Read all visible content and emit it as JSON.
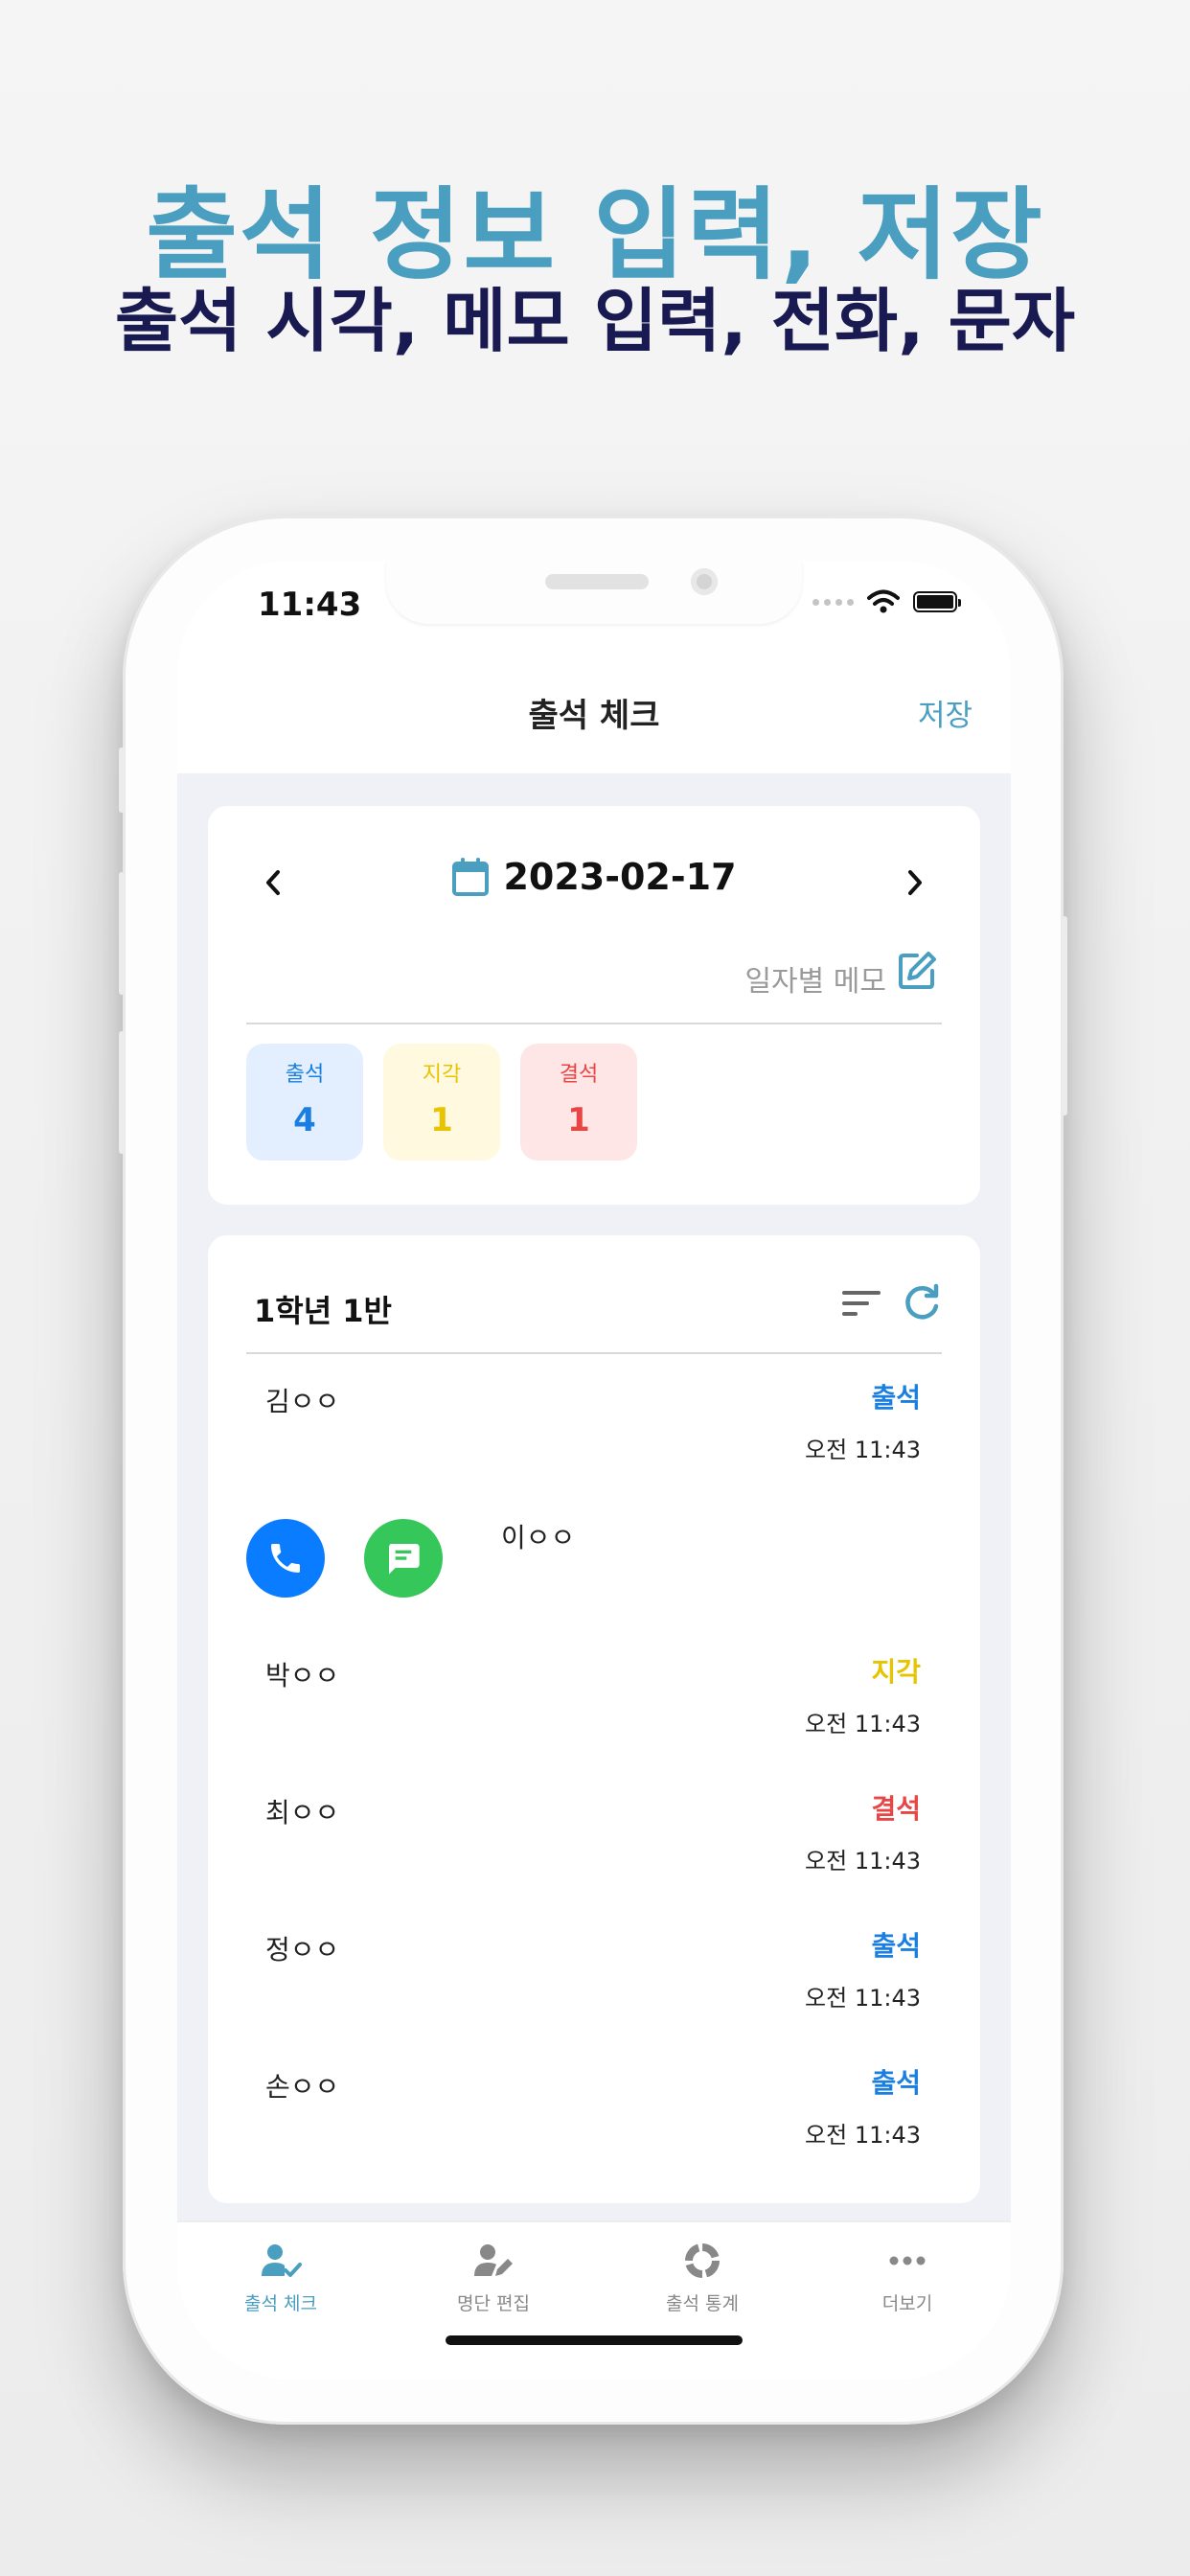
{
  "promo": {
    "title": "출석 정보 입력, 저장",
    "subtitle": "출석 시각, 메모 입력, 전화, 문자"
  },
  "status_bar": {
    "time": "11:43"
  },
  "navbar": {
    "title": "출석 체크",
    "save_label": "저장"
  },
  "date_card": {
    "date": "2023-02-17",
    "memo_placeholder": "일자별 메모",
    "stats": [
      {
        "label": "출석",
        "count": "4"
      },
      {
        "label": "지각",
        "count": "1"
      },
      {
        "label": "결석",
        "count": "1"
      }
    ]
  },
  "class_card": {
    "class_name": "1학년 1반",
    "rows": [
      {
        "name": "김ㅇㅇ",
        "status": "출석",
        "time": "오전 11:43"
      },
      {
        "name": "이ㅇㅇ",
        "status": "",
        "time": ""
      },
      {
        "name": "박ㅇㅇ",
        "status": "지각",
        "time": "오전 11:43"
      },
      {
        "name": "최ㅇㅇ",
        "status": "결석",
        "time": "오전 11:43"
      },
      {
        "name": "정ㅇㅇ",
        "status": "출석",
        "time": "오전 11:43"
      },
      {
        "name": "손ㅇㅇ",
        "status": "출석",
        "time": "오전 11:43"
      }
    ]
  },
  "tabs": [
    {
      "label": "출석 체크",
      "icon": "person-check-icon",
      "active": true
    },
    {
      "label": "명단 편집",
      "icon": "person-edit-icon",
      "active": false
    },
    {
      "label": "출석 통계",
      "icon": "donut-chart-icon",
      "active": false
    },
    {
      "label": "더보기",
      "icon": "more-icon",
      "active": false
    }
  ],
  "colors": {
    "promo_title": "#4a9ec0",
    "promo_subtitle": "#1a1a52",
    "accent": "#4a9ec0",
    "present": "#1a7fe0",
    "late": "#e8c300",
    "absent": "#e84545",
    "present_bg": "#e3efff",
    "late_bg": "#fff9e0",
    "absent_bg": "#ffe6e6",
    "call_button": "#0a7cff",
    "message_button": "#35c759",
    "tab_inactive": "#888888"
  }
}
